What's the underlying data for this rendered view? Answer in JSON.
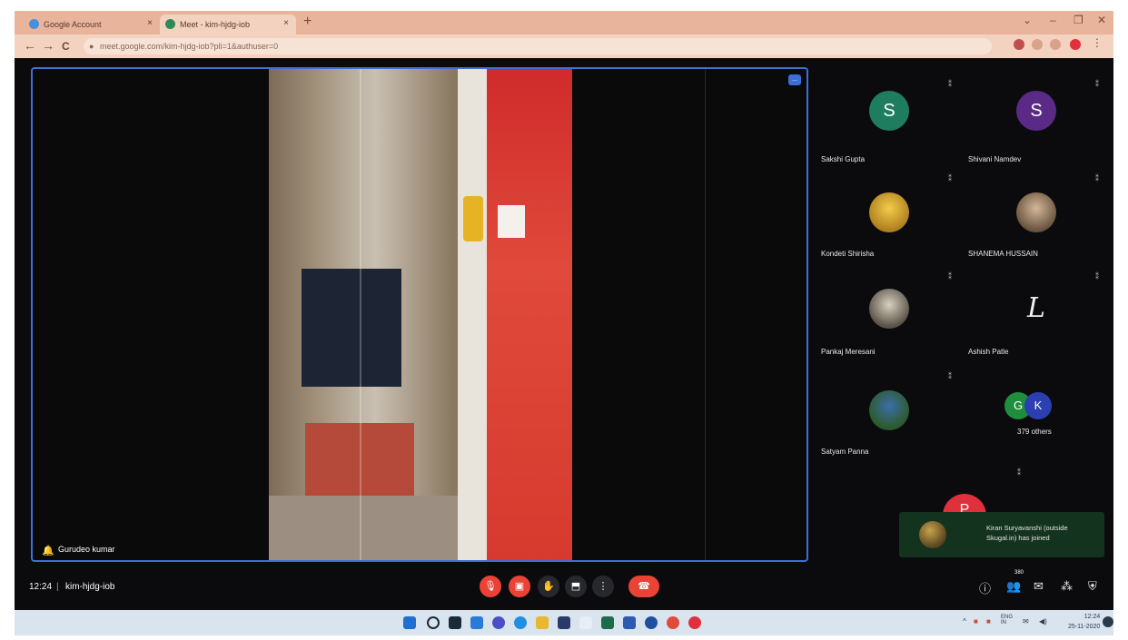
{
  "browser": {
    "tabs": [
      {
        "title": "Google Account",
        "close": "×",
        "favicon_color": "#4a90d9"
      },
      {
        "title": "Meet - kim-hjdg-iob",
        "close": "×",
        "favicon_color": "#2e8b57"
      }
    ],
    "new_tab": "+",
    "address": "meet.google.com/kim-hjdg-iob?pli=1&authuser=0",
    "nav": {
      "back": "←",
      "forward": "→",
      "reload": "C"
    },
    "window": {
      "minimize": "–",
      "restore": "❐",
      "close": "✕",
      "chevron": "⌄"
    }
  },
  "main_video": {
    "speaker_name": "Gurudeo kumar",
    "pin_label": "..."
  },
  "participants": [
    {
      "name": "Sakshi Gupta",
      "initial": "S",
      "color": "#1e7d5e",
      "type": "initial"
    },
    {
      "name": "Shivani Namdev",
      "initial": "S",
      "color": "#5b2a86",
      "type": "initial"
    },
    {
      "name": "Kondeti Shirisha",
      "type": "photo",
      "color": "#e2b93b"
    },
    {
      "name": "SHANEMA HUSSAIN",
      "type": "photo",
      "color": "#a88a6a"
    },
    {
      "name": "Pankaj Meresani",
      "type": "photo",
      "color": "#8c8c8c"
    },
    {
      "name": "Ashish Patle",
      "initial": "L",
      "type": "glyph",
      "color": "#ffffff"
    },
    {
      "name": "Satyam Panna",
      "type": "photo",
      "color": "#4a7a3a"
    },
    {
      "name": "379 others",
      "type": "stack",
      "initials": [
        "G",
        "K"
      ],
      "colors": [
        "#1e8e3e",
        "#2b3fb0"
      ]
    }
  ],
  "notification": {
    "message": "Kiran Suryavanshi (outside Skugal.in) has joined"
  },
  "overflow_avatar": {
    "initial": "P",
    "color": "#e0303c"
  },
  "bottom_bar": {
    "time": "12:24",
    "separator": "|",
    "meeting_code": "kim-hjdg-iob",
    "controls": [
      "mic-off",
      "camera-off",
      "raise-hand",
      "present",
      "more"
    ],
    "people_count": "380"
  },
  "taskbar": {
    "date": "25-11-2020",
    "time": "12:24",
    "lang": "ENG",
    "lang2": "IN"
  }
}
